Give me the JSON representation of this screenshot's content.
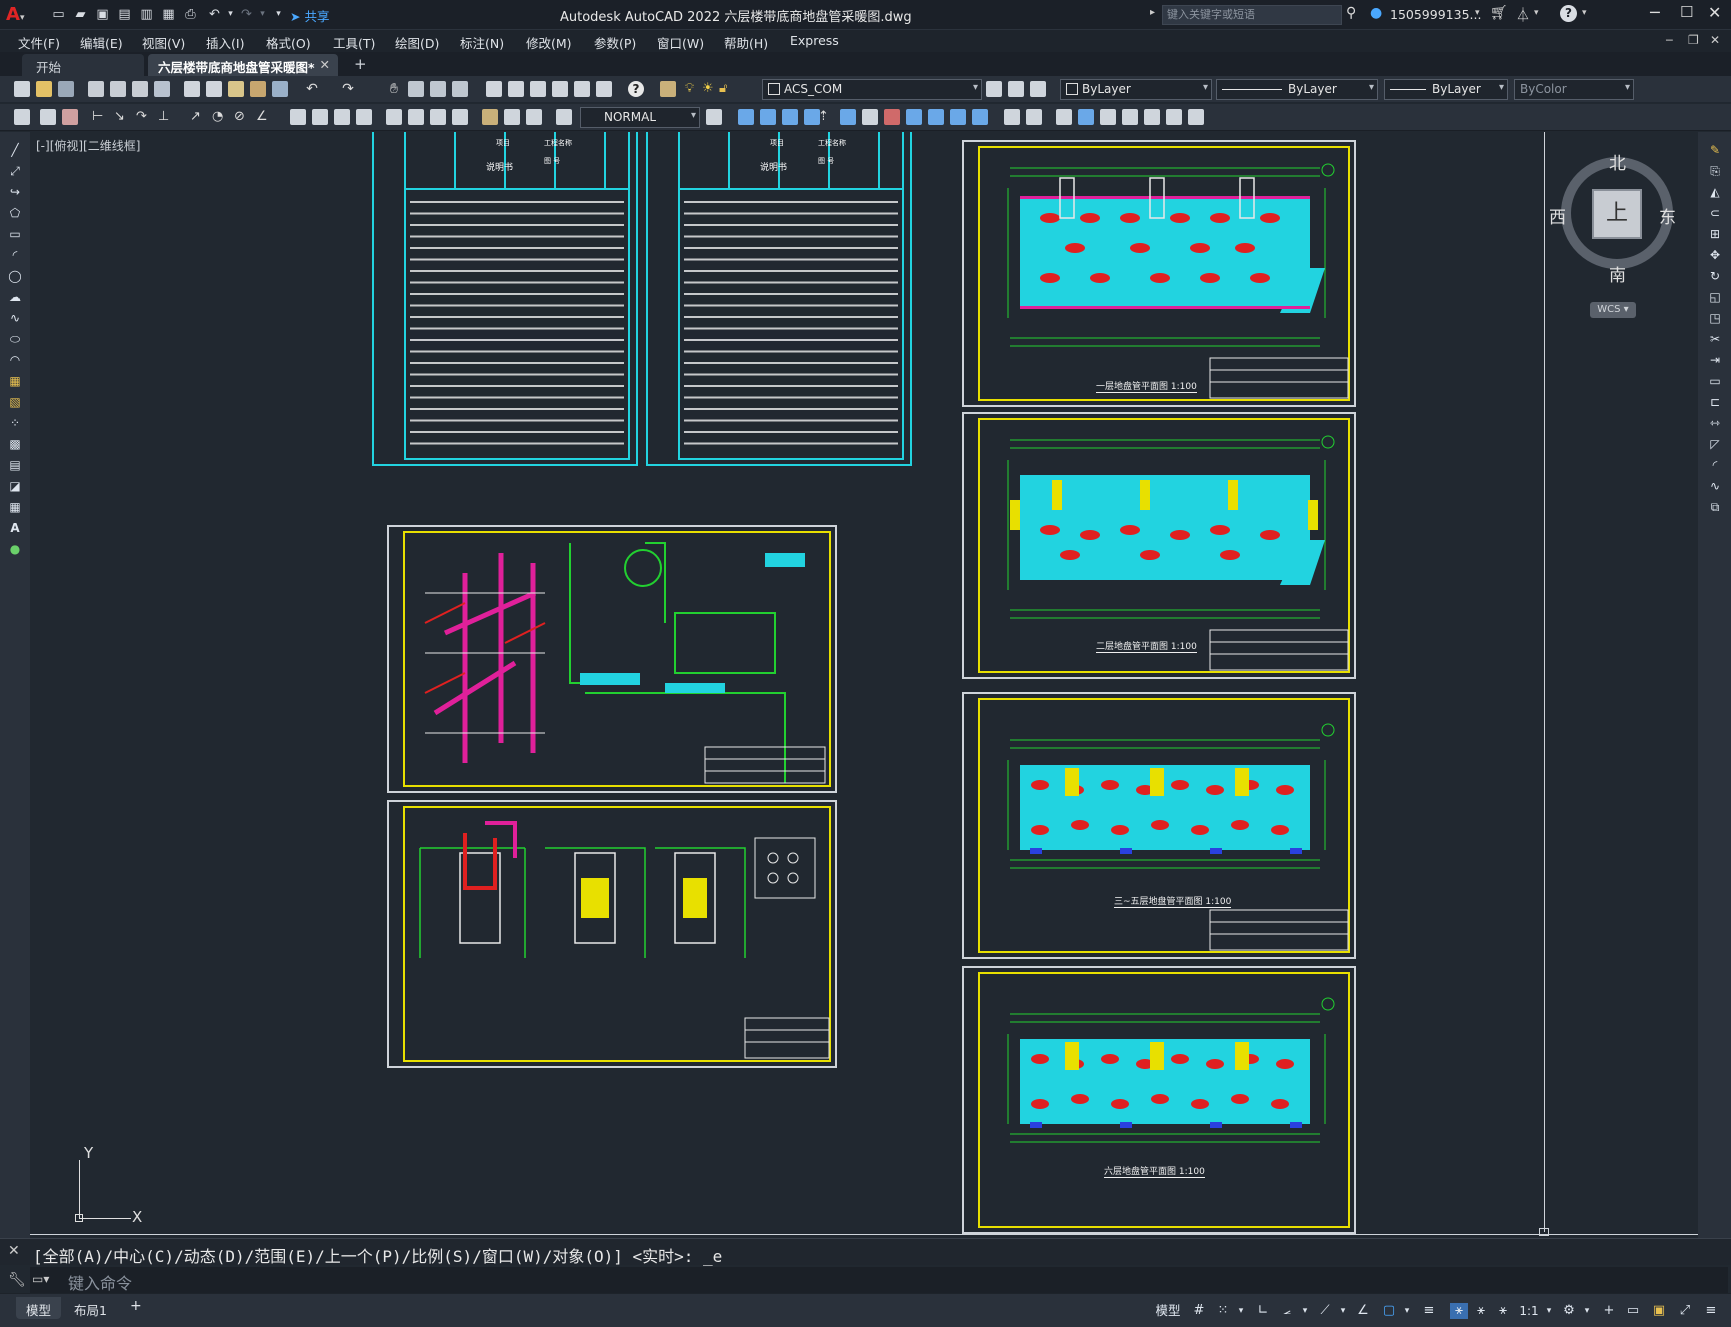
{
  "app": {
    "title": "Autodesk AutoCAD 2022    六层楼带底商地盘管采暖图.dwg",
    "search_placeholder": "键入关键字或短语",
    "user": "1505999135...",
    "share_label": "共享"
  },
  "menu": [
    "文件(F)",
    "编辑(E)",
    "视图(V)",
    "插入(I)",
    "格式(O)",
    "工具(T)",
    "绘图(D)",
    "标注(N)",
    "修改(M)",
    "参数(P)",
    "窗口(W)",
    "帮助(H)",
    "Express"
  ],
  "tabs": [
    {
      "label": "开始",
      "active": false
    },
    {
      "label": "六层楼带底商地盘管采暖图*",
      "active": true
    }
  ],
  "toolbar": {
    "layer": "ACS_COM",
    "color": "ByLayer",
    "linetype": "ByLayer",
    "lineweight": "ByLayer",
    "plotstyle": "ByColor",
    "textstyle": "NORMAL"
  },
  "viewport": {
    "label": "[-][俯视][二维线框]"
  },
  "viewcube": {
    "north": "北",
    "south": "南",
    "east": "东",
    "west": "西",
    "face": "上",
    "wcs": "WCS"
  },
  "ucs": {
    "x": "X",
    "y": "Y"
  },
  "drawings": {
    "note_header_title": "说明书",
    "note_cell_project": "项目",
    "note_cell_name": "工程名称",
    "note_cell_no": "图 号",
    "plan1": "一层地盘管平面图 1:100",
    "plan2": "二层地盘管平面图 1:100",
    "plan3": "三~五层地盘管平面图 1:100",
    "plan4": "六层地盘管平面图 1:100"
  },
  "command": {
    "history": "[全部(A)/中心(C)/动态(D)/范围(E)/上一个(P)/比例(S)/窗口(W)/对象(O)] <实时>: _e",
    "placeholder": "键入命令"
  },
  "status": {
    "layout_tabs": [
      "模型",
      "布局1"
    ],
    "model_label": "模型",
    "scale": "1:1"
  },
  "colors": {
    "cyan": "#22d3e0",
    "yellow": "#e8e000",
    "magenta": "#e0209a",
    "red": "#e02020",
    "green": "#22d030",
    "canvas": "#212830"
  }
}
